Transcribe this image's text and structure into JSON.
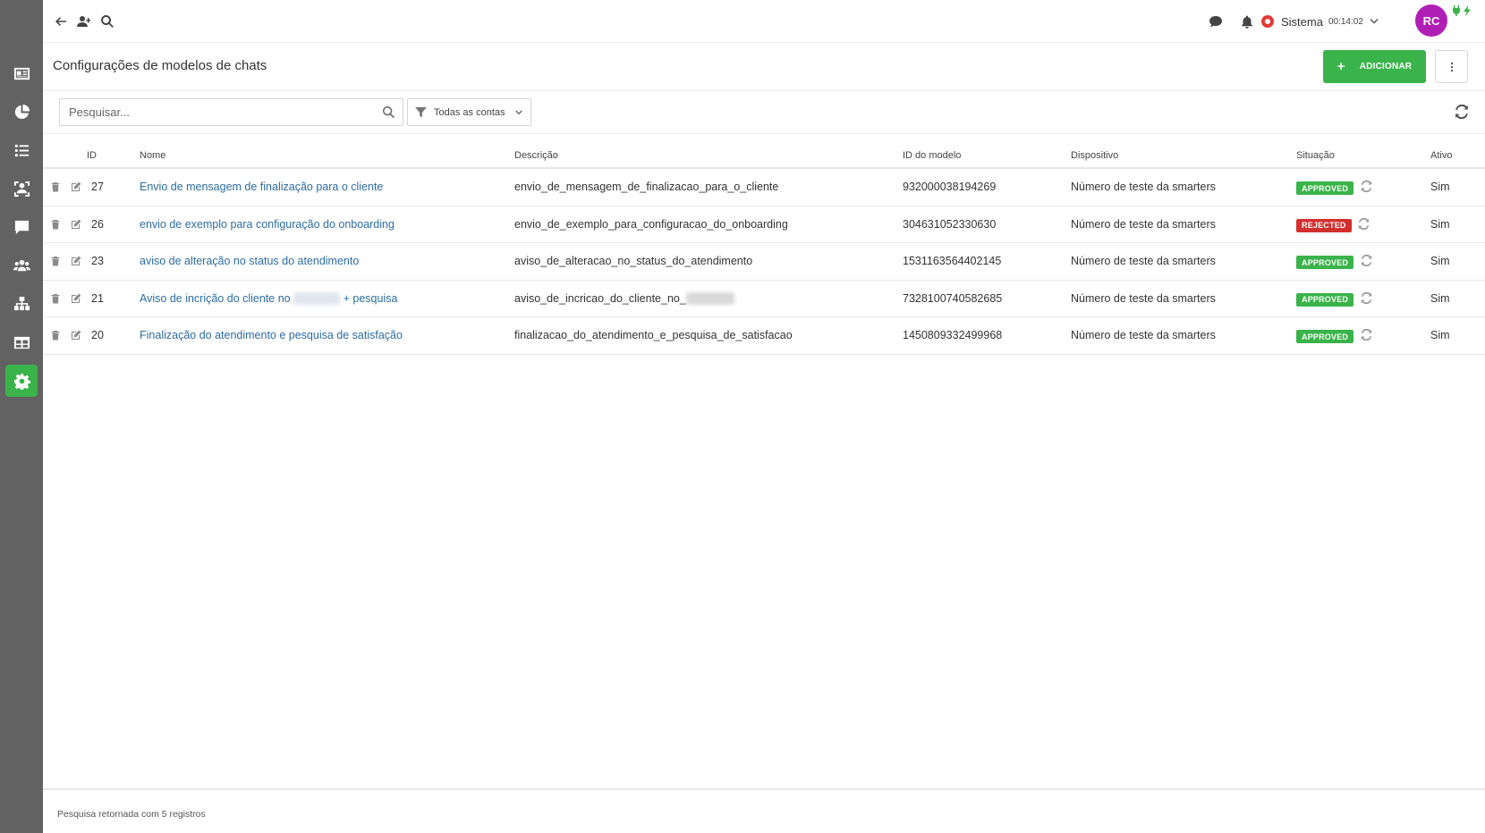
{
  "topbar": {
    "system_label": "Sistema",
    "system_time": "00:14:02",
    "avatar_initials": "RC",
    "avatar_color": "#b01fb5"
  },
  "sidebar": {
    "items": [
      {
        "name": "contacts",
        "icon": "id-card-icon"
      },
      {
        "name": "reports",
        "icon": "pie-chart-icon"
      },
      {
        "name": "lists",
        "icon": "list-icon"
      },
      {
        "name": "attendance",
        "icon": "face-scan-icon"
      },
      {
        "name": "chat",
        "icon": "chat-icon"
      },
      {
        "name": "users",
        "icon": "users-icon"
      },
      {
        "name": "structure",
        "icon": "sitemap-icon"
      },
      {
        "name": "tables",
        "icon": "table-icon"
      },
      {
        "name": "settings",
        "icon": "gear-icon",
        "active": true
      }
    ],
    "active_color": "#3ab34a"
  },
  "header": {
    "title": "Configurações de modelos de chats",
    "add_label": "ADICIONAR"
  },
  "filters": {
    "search_placeholder": "Pesquisar...",
    "accounts_label": "Todas as contas"
  },
  "table": {
    "columns": {
      "id": "ID",
      "name": "Nome",
      "description": "Descrição",
      "model_id": "ID do modelo",
      "device": "Dispositivo",
      "status": "Situação",
      "active": "Ativo"
    },
    "rows": [
      {
        "id": "27",
        "name": "Envio de mensagem de finalização para o cliente",
        "description": "envio_de_mensagem_de_finalizacao_para_o_cliente",
        "model_id": "932000038194269",
        "device": "Número de teste da smarters",
        "status": "APPROVED",
        "active": "Sim"
      },
      {
        "id": "26",
        "name": "envio de exemplo para configuração do onboarding",
        "description": "envio_de_exemplo_para_configuracao_do_onboarding",
        "model_id": "304631052330630",
        "device": "Número de teste da smarters",
        "status": "REJECTED",
        "active": "Sim"
      },
      {
        "id": "23",
        "name": "aviso de alteração no status do atendimento",
        "description": "aviso_de_alteracao_no_status_do_atendimento",
        "model_id": "1531163564402145",
        "device": "Número de teste da smarters",
        "status": "APPROVED",
        "active": "Sim"
      },
      {
        "id": "21",
        "name_prefix": "Aviso de incrição do cliente no",
        "name_suffix": "+ pesquisa",
        "description_prefix": "aviso_de_incricao_do_cliente_no_",
        "model_id": "7328100740582685",
        "device": "Número de teste da smarters",
        "status": "APPROVED",
        "active": "Sim"
      },
      {
        "id": "20",
        "name": "Finalização do atendimento e pesquisa de satisfação",
        "description": "finalizacao_do_atendimento_e_pesquisa_de_satisfacao",
        "model_id": "1450809332499968",
        "device": "Número de teste da smarters",
        "status": "APPROVED",
        "active": "Sim"
      }
    ]
  },
  "footer": {
    "result_text": "Pesquisa retornada com 5 registros"
  },
  "colors": {
    "approved": "#3ab34a",
    "rejected": "#d32f2f",
    "link": "#2d6ca3",
    "sidebar_bg": "#626262"
  }
}
